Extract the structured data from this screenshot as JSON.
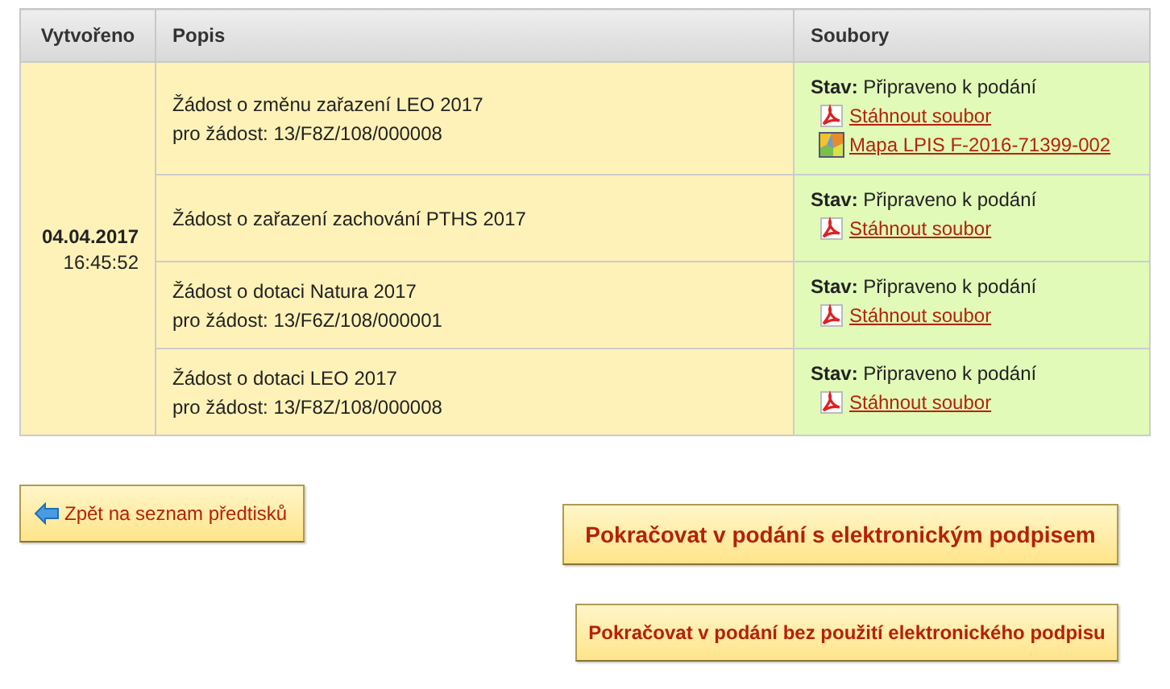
{
  "table": {
    "columns": [
      "Vytvořeno",
      "Popis",
      "Soubory"
    ],
    "created": {
      "date": "04.04.2017",
      "time": "16:45:52"
    },
    "rows": [
      {
        "title": "Žádost o změnu zařazení LEO 2017",
        "reference": "pro žádost: 13/F8Z/108/000008",
        "status": "**Stav:** Připraveno k podání",
        "files": [
          {
            "kind": "pdf",
            "label": "Stáhnout soubor"
          },
          {
            "kind": "map",
            "label": "Mapa LPIS F-2016-71399-002"
          }
        ]
      },
      {
        "title": "Žádost o zařazení zachování PTHS 2017",
        "status": "**Stav:** Připraveno k podání",
        "files": [
          {
            "kind": "pdf",
            "label": "Stáhnout soubor"
          }
        ]
      },
      {
        "title": "Žádost o dotaci Natura 2017",
        "reference": "pro žádost: 13/F6Z/108/000001",
        "status": "**Stav:** Připraveno k podání",
        "files": [
          {
            "kind": "pdf",
            "label": "Stáhnout soubor"
          }
        ]
      },
      {
        "title": "Žádost o dotaci LEO 2017",
        "reference": "pro žádost: 13/F8Z/108/000008",
        "status": "**Stav:** Připraveno k podání",
        "files": [
          {
            "kind": "pdf",
            "label": "Stáhnout soubor"
          }
        ]
      }
    ]
  },
  "back_button": "Zpět na seznam předtisků",
  "actions": [
    {
      "kind": "primary",
      "label": "Pokračovat v podání s elektronickým podpisem"
    },
    {
      "kind": "secondary",
      "label": "Pokračovat v podání bez použití elektronického podpisu"
    }
  ]
}
